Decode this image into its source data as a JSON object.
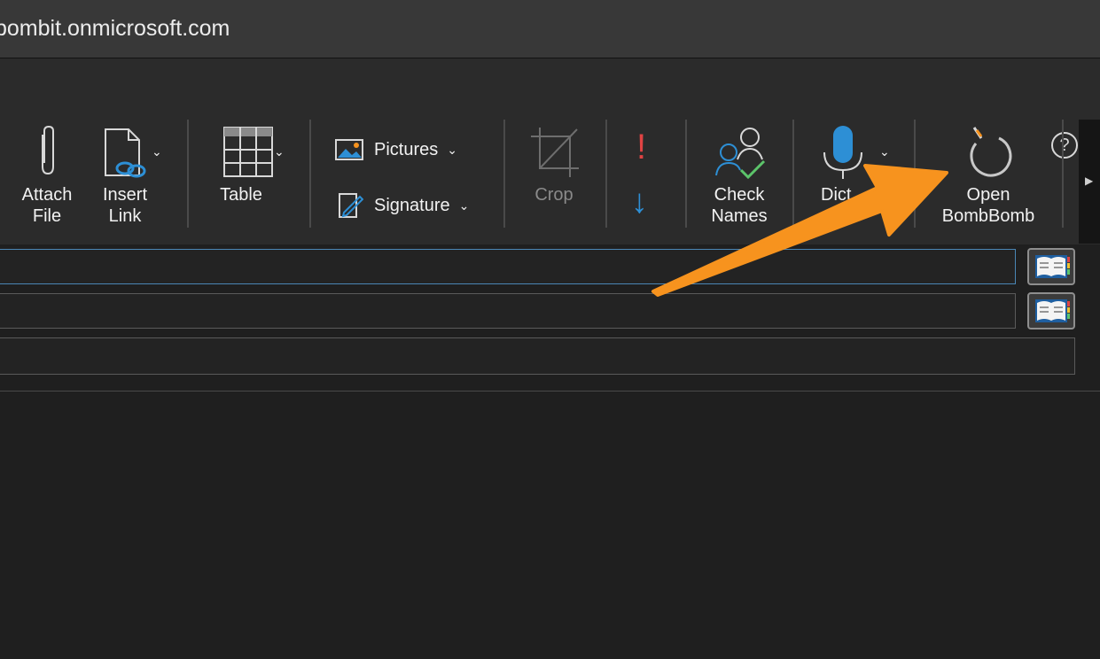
{
  "window": {
    "title": "bombit.onmicrosoft.com"
  },
  "ribbon": {
    "help_label": "?",
    "attach": {
      "label": "Attach\nFile"
    },
    "insert_link": {
      "label": "Insert\nLink"
    },
    "table": {
      "label": "Table"
    },
    "pictures": {
      "label": "Pictures"
    },
    "signature": {
      "label": "Signature"
    },
    "crop": {
      "label": "Crop"
    },
    "priority_high_glyph": "!",
    "priority_low_glyph": "↓",
    "check_names": {
      "label": "Check\nNames"
    },
    "dictate": {
      "label": "Dict"
    },
    "open_bombbomb": {
      "label": "Open\nBombBomb"
    },
    "more_glyph": "▶"
  },
  "fields": [
    {
      "value": ""
    },
    {
      "value": ""
    },
    {
      "value": ""
    }
  ],
  "colors": {
    "accent_arrow": "#f7931e",
    "brand_blue": "#2d8fd5"
  }
}
